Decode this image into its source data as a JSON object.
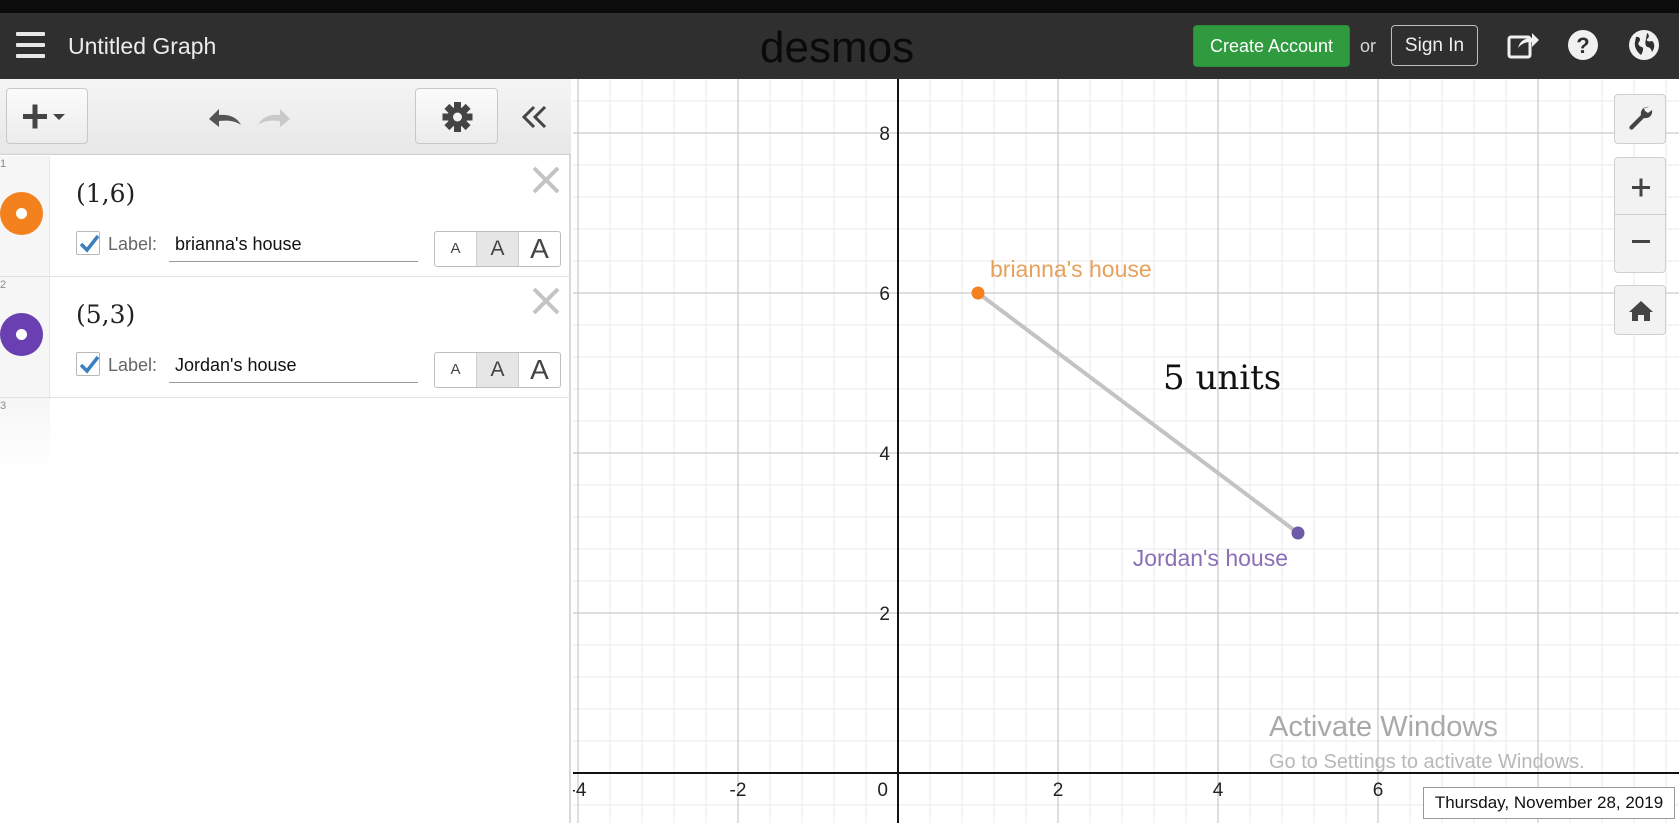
{
  "header": {
    "graph_title": "Untitled Graph",
    "brand": "desmos",
    "create_account_label": "Create Account",
    "or_label": "or",
    "sign_in_label": "Sign In"
  },
  "expressions": [
    {
      "index": "1",
      "math": "(1,6)",
      "label_caption": "Label:",
      "label_value": "brianna's house",
      "color": "#f3811d",
      "size_buttons": [
        "A",
        "A",
        "A"
      ]
    },
    {
      "index": "2",
      "math": "(5,3)",
      "label_caption": "Label:",
      "label_value": "Jordan's house",
      "color": "#6a3fb1",
      "size_buttons": [
        "A",
        "A",
        "A"
      ]
    },
    {
      "index": "3"
    }
  ],
  "graph": {
    "x_ticks": [
      "-4",
      "-2",
      "0",
      "2",
      "4",
      "6"
    ],
    "y_ticks": [
      "2",
      "4",
      "6",
      "8"
    ],
    "points": [
      {
        "x": 1,
        "y": 6,
        "label": "brianna's house",
        "color": "#f3811d",
        "label_color": "#e8a15a"
      },
      {
        "x": 5,
        "y": 3,
        "label": "Jordan's house",
        "color": "#6f5aa8",
        "label_color": "#8a6fb7"
      }
    ],
    "segment_color": "#c3c3c3",
    "annotation": "5 units"
  },
  "watermark": {
    "title": "Activate Windows",
    "subtitle": "Go to Settings to activate Windows."
  },
  "taskbar_date": "Thursday, November 28, 2019"
}
